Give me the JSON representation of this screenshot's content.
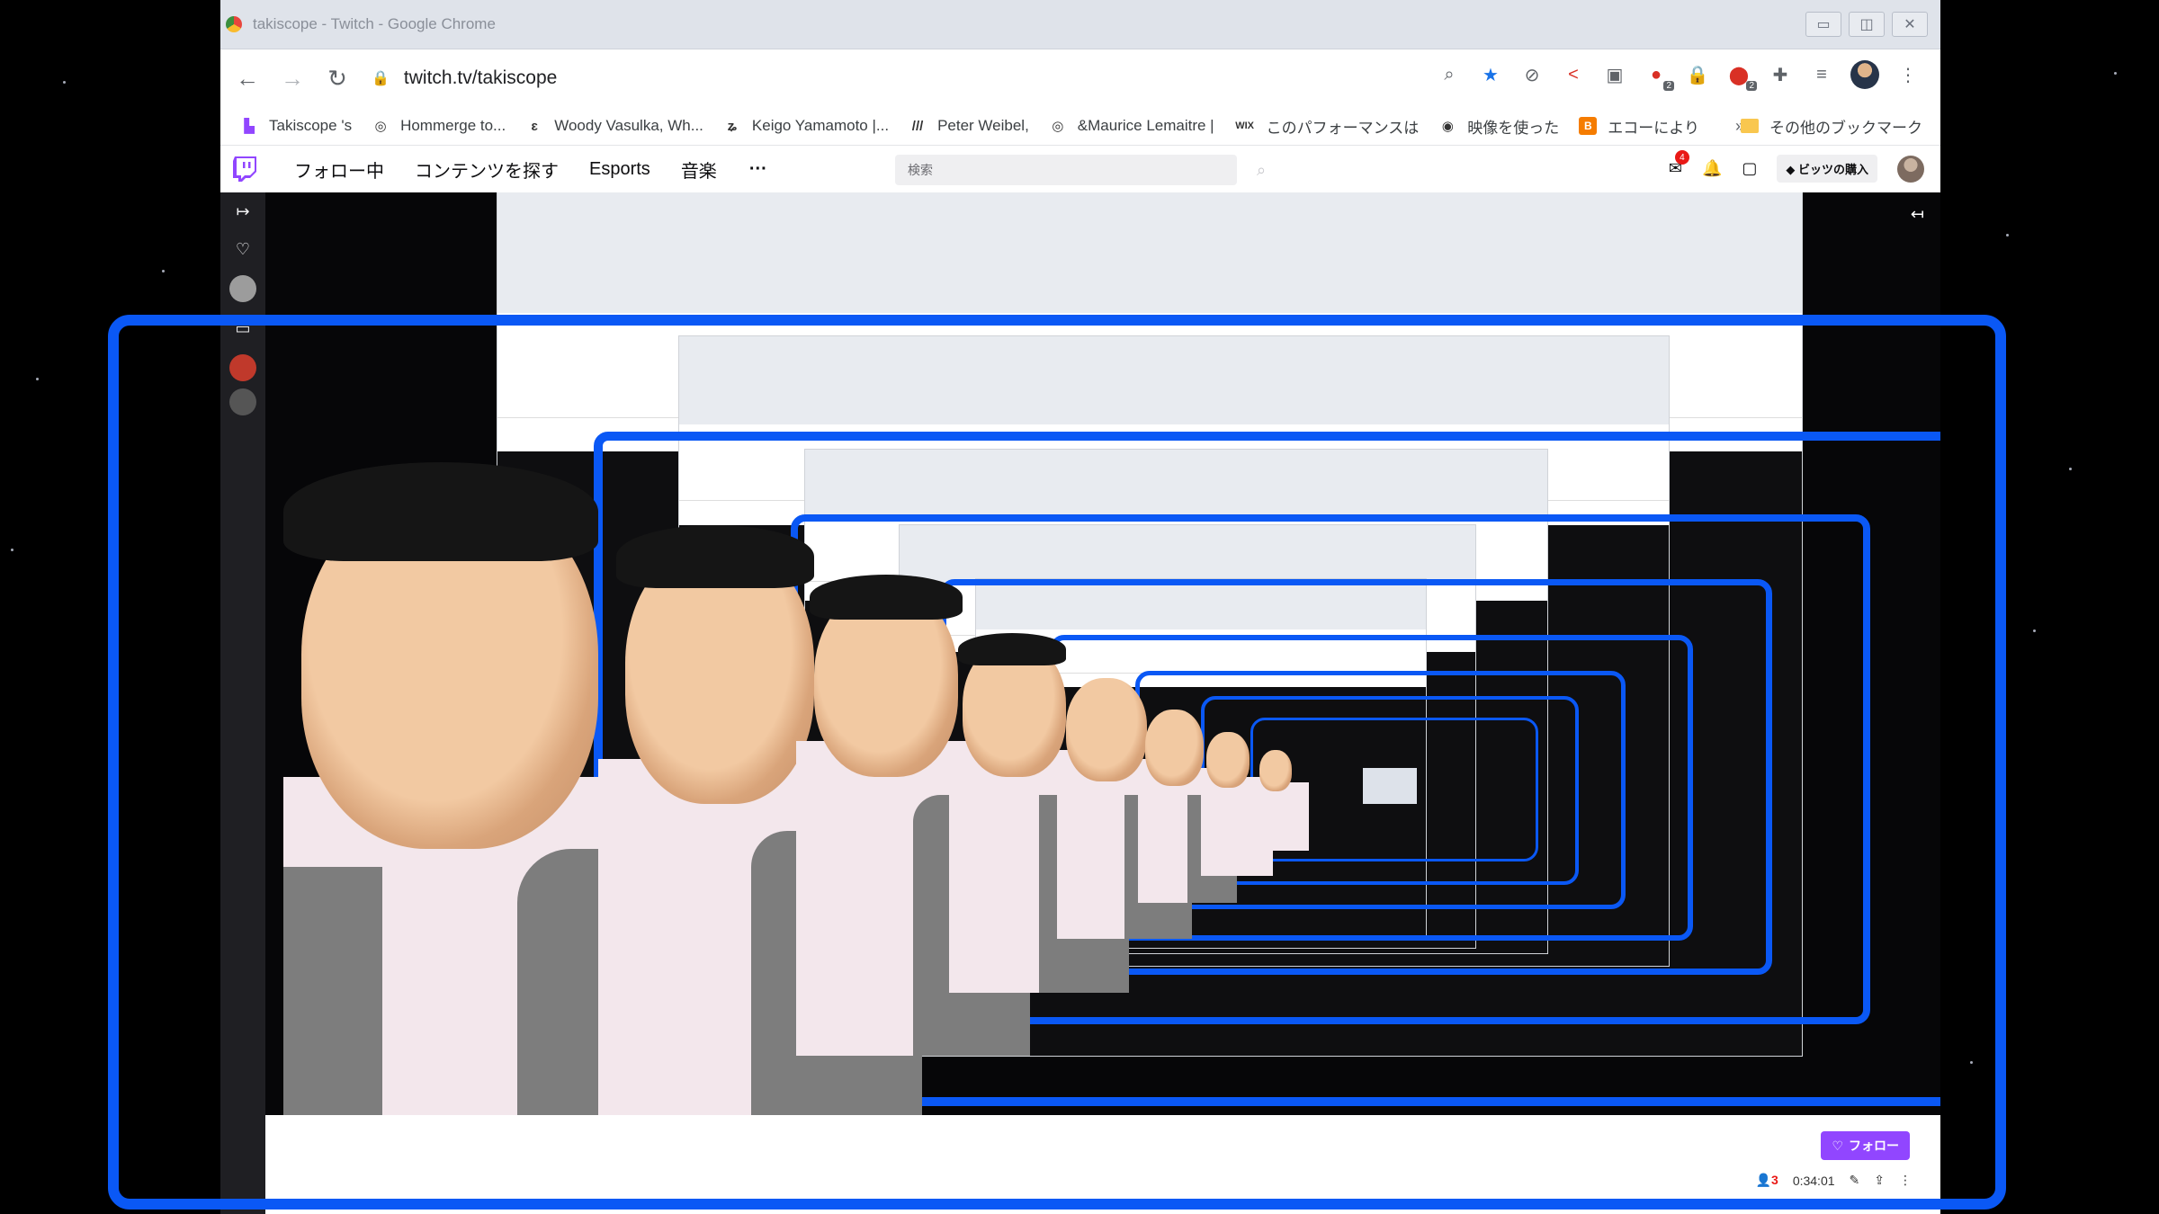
{
  "window": {
    "title": "takiscope - Twitch - Google Chrome",
    "minimize": "▭",
    "maximize": "◫",
    "close": "✕"
  },
  "toolbar": {
    "url": "twitch.tv/takiscope",
    "back": "←",
    "forward": "→",
    "reload": "↻"
  },
  "bookmarks": [
    {
      "label": "Takiscope 's",
      "icon": "twitch-icon"
    },
    {
      "label": "Hommerge to...",
      "icon": "globe-icon"
    },
    {
      "label": "Woody Vasulka, Wh...",
      "icon": "e-icon"
    },
    {
      "label": "Keigo Yamamoto |...",
      "icon": "z-icon"
    },
    {
      "label": "Peter Weibel,",
      "icon": "slash-icon"
    },
    {
      "label": "&Maurice Lemaitre |",
      "icon": "globe-icon"
    },
    {
      "label": "このパフォーマンスは",
      "icon": "wix-icon"
    },
    {
      "label": "映像を使った",
      "icon": "circle-icon"
    },
    {
      "label": "エコーにより",
      "icon": "blogger-icon"
    }
  ],
  "bookmarks_more": "»",
  "bookmarks_other": "その他のブックマーク",
  "twitch_nav": {
    "following": "フォロー中",
    "browse": "コンテンツを探す",
    "esports": "Esports",
    "music": "音楽",
    "more": "···",
    "search_placeholder": "検索",
    "notification_count": "4",
    "bits_label": "ビッツの購入"
  },
  "stream": {
    "follow_label": "フォロー",
    "viewers": "3",
    "uptime": "0:34:01"
  },
  "colors": {
    "frame_blue": "#0a58f5",
    "twitch_purple": "#9146ff"
  }
}
